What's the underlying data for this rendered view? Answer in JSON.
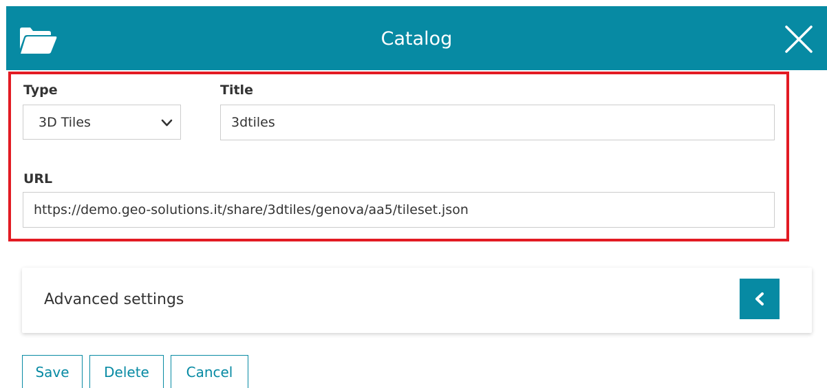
{
  "header": {
    "title": "Catalog",
    "icon": "folder-open-icon",
    "close_icon": "close-icon",
    "color": "#078aa3"
  },
  "highlight": {
    "color": "#e21b23"
  },
  "form": {
    "type_label": "Type",
    "type_value": "3D Tiles",
    "title_label": "Title",
    "title_value": "3dtiles",
    "url_label": "URL",
    "url_value": "https://demo.geo-solutions.it/share/3dtiles/genova/aa5/tileset.json"
  },
  "advanced": {
    "title": "Advanced settings",
    "toggle_icon": "chevron-left-icon"
  },
  "actions": {
    "save_label": "Save",
    "delete_label": "Delete",
    "cancel_label": "Cancel"
  }
}
